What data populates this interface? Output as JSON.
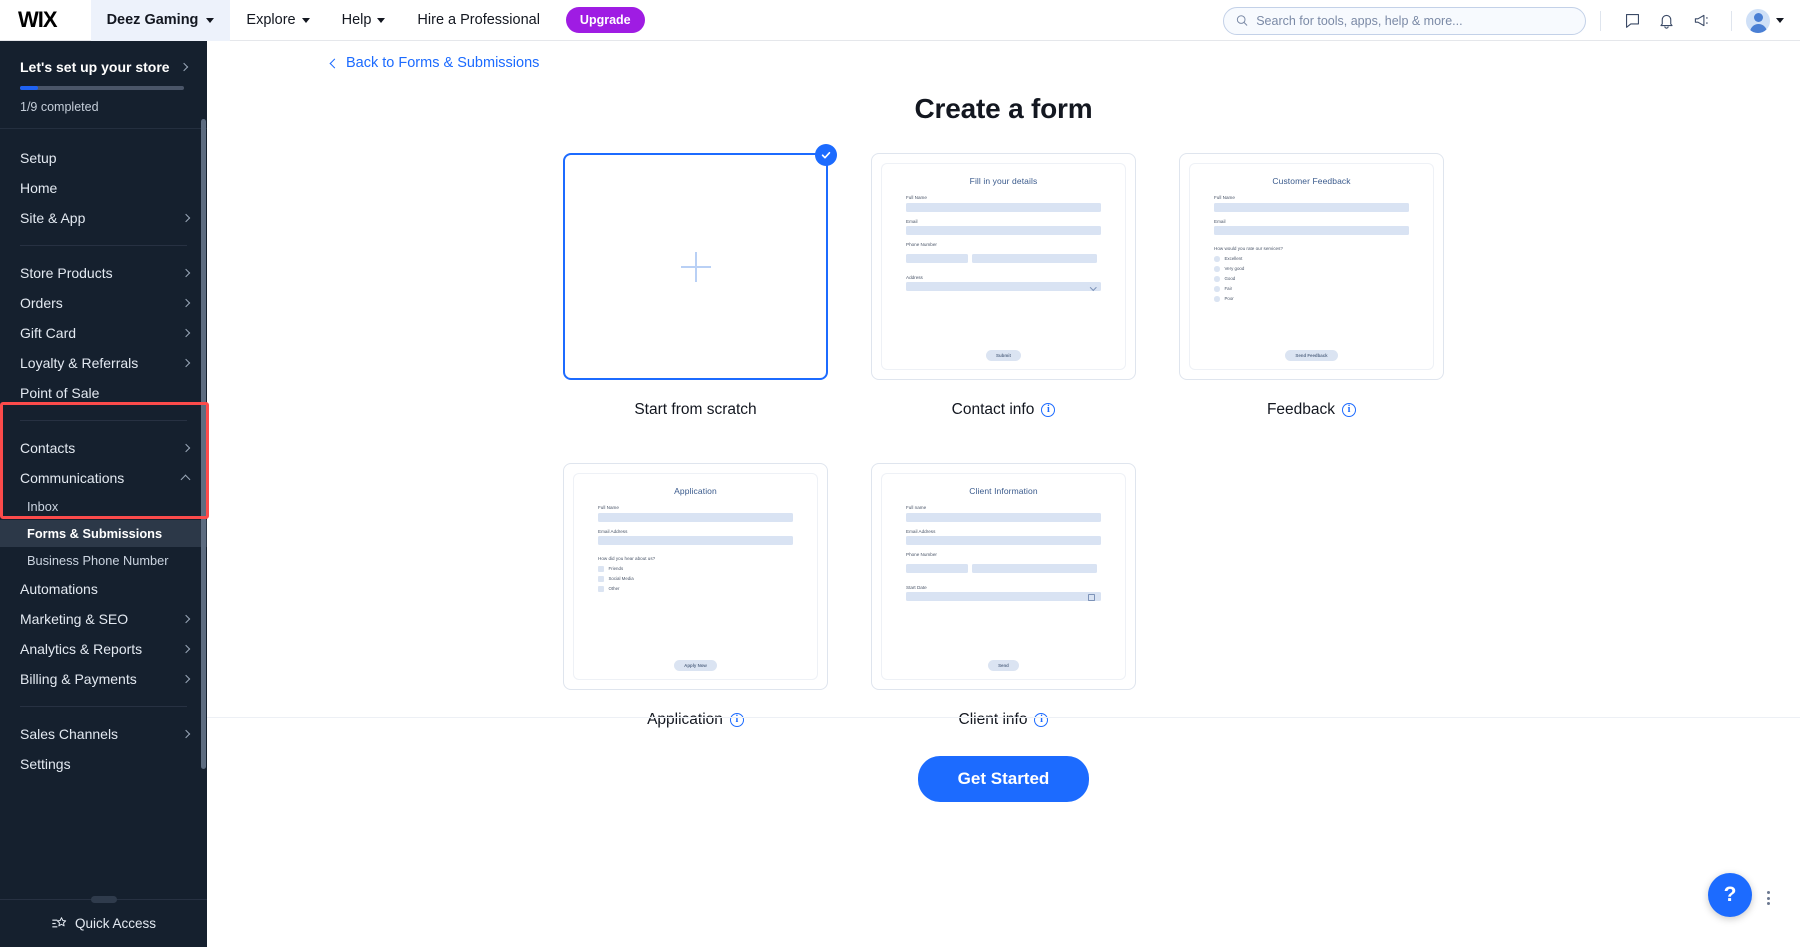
{
  "topbar": {
    "logo": "WIX",
    "site_name": "Deez Gaming",
    "nav": [
      {
        "label": "Explore",
        "has_caret": true
      },
      {
        "label": "Help",
        "has_caret": true
      },
      {
        "label": "Hire a Professional",
        "has_caret": false
      }
    ],
    "upgrade_label": "Upgrade",
    "search_placeholder": "Search for tools, apps, help & more...",
    "icons": [
      "chat-icon",
      "bell-icon",
      "megaphone-icon"
    ]
  },
  "sidebar": {
    "setup": {
      "title": "Let's set up your store",
      "progress_text": "1/9 completed",
      "progress_percent": 11
    },
    "groups": [
      {
        "items": [
          {
            "label": "Setup",
            "arrow": false
          },
          {
            "label": "Home",
            "arrow": false
          },
          {
            "label": "Site & App",
            "arrow": true
          }
        ]
      },
      {
        "items": [
          {
            "label": "Store Products",
            "arrow": true
          },
          {
            "label": "Orders",
            "arrow": true
          },
          {
            "label": "Gift Card",
            "arrow": true
          },
          {
            "label": "Loyalty & Referrals",
            "arrow": true
          },
          {
            "label": "Point of Sale",
            "arrow": false
          }
        ]
      },
      {
        "items": [
          {
            "label": "Contacts",
            "arrow": true
          },
          {
            "label": "Communications",
            "arrow": true,
            "expanded": true
          },
          {
            "label": "Inbox",
            "sub": true
          },
          {
            "label": "Forms & Submissions",
            "sub": true,
            "active": true
          },
          {
            "label": "Business Phone Number",
            "sub": true
          },
          {
            "label": "Automations",
            "arrow": false
          },
          {
            "label": "Marketing & SEO",
            "arrow": true
          },
          {
            "label": "Analytics & Reports",
            "arrow": true
          },
          {
            "label": "Billing & Payments",
            "arrow": true
          }
        ]
      },
      {
        "items": [
          {
            "label": "Sales Channels",
            "arrow": true
          },
          {
            "label": "Settings",
            "arrow": false
          }
        ]
      }
    ],
    "footer_label": "Quick Access",
    "highlight_color": "#fc4b4b"
  },
  "main": {
    "back_link": "Back to Forms & Submissions",
    "title": "Create a form",
    "cta_label": "Get Started",
    "accent_color": "#1c6bff",
    "cards": [
      {
        "label": "Start from scratch",
        "selected": true,
        "has_info": false,
        "preview": {
          "kind": "blank"
        }
      },
      {
        "label": "Contact info",
        "selected": false,
        "has_info": true,
        "preview": {
          "kind": "form",
          "title": "Fill in your details",
          "fields": [
            {
              "label": "Full Name",
              "type": "text"
            },
            {
              "label": "Email",
              "type": "text"
            },
            {
              "label": "Phone Number",
              "type": "split"
            },
            {
              "label": "Address",
              "type": "select"
            }
          ],
          "button": "Submit"
        }
      },
      {
        "label": "Feedback",
        "selected": false,
        "has_info": true,
        "preview": {
          "kind": "form",
          "title": "Customer Feedback",
          "fields": [
            {
              "label": "Full Name",
              "type": "text"
            },
            {
              "label": "Email",
              "type": "text"
            }
          ],
          "question": "How would you rate our services?",
          "option_type": "radio",
          "options": [
            "Excellent",
            "Very good",
            "Good",
            "Fair",
            "Poor"
          ],
          "button": "Send Feedback"
        }
      },
      {
        "label": "Application",
        "selected": false,
        "has_info": true,
        "preview": {
          "kind": "form",
          "title": "Application",
          "fields": [
            {
              "label": "Full Name",
              "type": "text"
            },
            {
              "label": "Email Address",
              "type": "text"
            }
          ],
          "question": "How did you hear about us?",
          "option_type": "checkbox",
          "options": [
            "Friends",
            "Social Media",
            "Other"
          ],
          "button": "Apply Now"
        }
      },
      {
        "label": "Client info",
        "selected": false,
        "has_info": true,
        "preview": {
          "kind": "form",
          "title": "Client Information",
          "fields": [
            {
              "label": "Full name",
              "type": "text"
            },
            {
              "label": "Email Address",
              "type": "text"
            },
            {
              "label": "Phone Number",
              "type": "split"
            },
            {
              "label": "Start Date",
              "type": "date"
            }
          ],
          "button": "Send"
        }
      }
    ],
    "help_label": "?"
  }
}
